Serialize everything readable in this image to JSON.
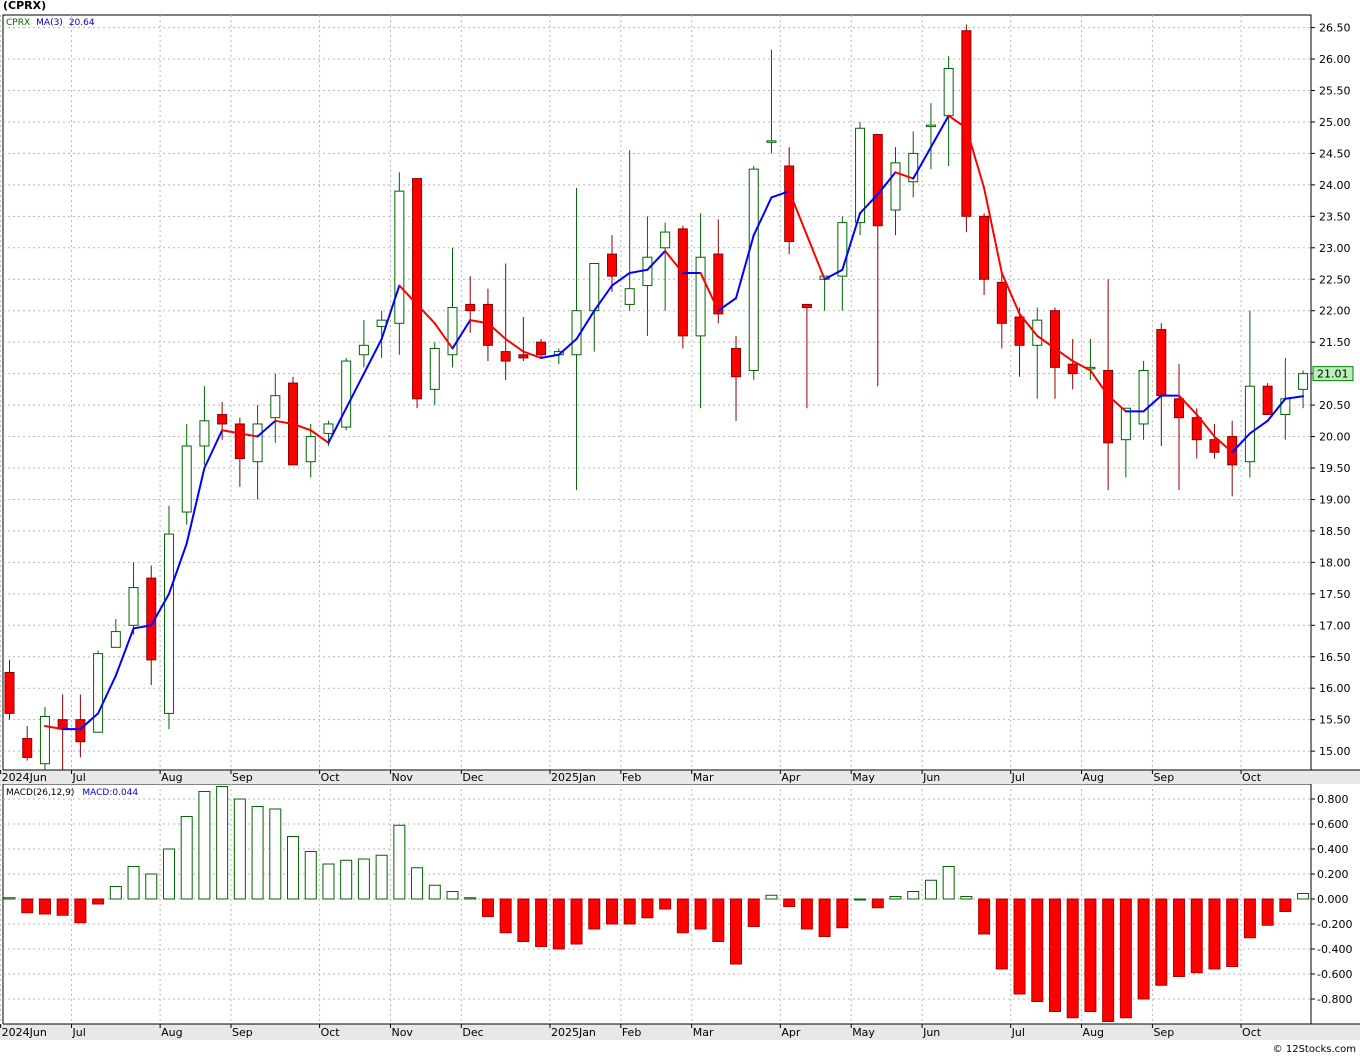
{
  "title": "(CPRX)",
  "credit": "© 12Stocks.com",
  "price_legend": {
    "symbol": "CPRX",
    "ma_label": "MA(3)",
    "ma_value": "20.64"
  },
  "macd_legend": {
    "label": "MACD(26,12,9)",
    "value": "MACD:0.044"
  },
  "last_price_tag": "21.01",
  "colors": {
    "up": "#006400",
    "down": "#ff0000",
    "ma_up": "#0000ff",
    "ma_down": "#ff0000",
    "grid": "#b8b8b8",
    "axis_band": "#e8e8e8"
  },
  "chart_data": [
    {
      "type": "candlestick",
      "panel": "price",
      "ylim": [
        14.7,
        26.7
      ],
      "yticks": [
        "15.00",
        "15.50",
        "16.00",
        "16.50",
        "17.00",
        "17.50",
        "18.00",
        "18.50",
        "19.00",
        "19.50",
        "20.00",
        "20.50",
        "21.00",
        "21.50",
        "22.00",
        "22.50",
        "23.00",
        "23.50",
        "24.00",
        "24.50",
        "25.00",
        "25.50",
        "26.00",
        "26.50"
      ],
      "x_months": [
        {
          "label": "2024Jun",
          "week": 0
        },
        {
          "label": "Jul",
          "week": 4
        },
        {
          "label": "Aug",
          "week": 9
        },
        {
          "label": "Sep",
          "week": 13
        },
        {
          "label": "Oct",
          "week": 18
        },
        {
          "label": "Nov",
          "week": 22
        },
        {
          "label": "Dec",
          "week": 26
        },
        {
          "label": "2025Jan",
          "week": 31
        },
        {
          "label": "Feb",
          "week": 35
        },
        {
          "label": "Mar",
          "week": 39
        },
        {
          "label": "Apr",
          "week": 44
        },
        {
          "label": "May",
          "week": 48
        },
        {
          "label": "Jun",
          "week": 52
        },
        {
          "label": "Jul",
          "week": 57
        },
        {
          "label": "Aug",
          "week": 61
        },
        {
          "label": "Sep",
          "week": 65
        },
        {
          "label": "Oct",
          "week": 70
        }
      ],
      "candles": [
        {
          "o": 16.25,
          "h": 16.45,
          "l": 15.5,
          "c": 15.6
        },
        {
          "o": 15.2,
          "h": 15.4,
          "l": 14.85,
          "c": 14.9
        },
        {
          "o": 14.8,
          "h": 15.7,
          "l": 14.7,
          "c": 15.55
        },
        {
          "o": 15.5,
          "h": 15.9,
          "l": 14.7,
          "c": 15.35
        },
        {
          "o": 15.5,
          "h": 15.9,
          "l": 14.9,
          "c": 15.15
        },
        {
          "o": 15.3,
          "h": 16.6,
          "l": 15.3,
          "c": 16.55
        },
        {
          "o": 16.65,
          "h": 17.1,
          "l": 16.65,
          "c": 16.9
        },
        {
          "o": 17.0,
          "h": 18.0,
          "l": 16.85,
          "c": 17.6
        },
        {
          "o": 17.75,
          "h": 17.95,
          "l": 16.05,
          "c": 16.45
        },
        {
          "o": 15.6,
          "h": 18.9,
          "l": 15.35,
          "c": 18.45
        },
        {
          "o": 18.8,
          "h": 20.2,
          "l": 18.6,
          "c": 19.85
        },
        {
          "o": 19.85,
          "h": 20.8,
          "l": 19.55,
          "c": 20.25
        },
        {
          "o": 20.35,
          "h": 20.55,
          "l": 19.95,
          "c": 20.2
        },
        {
          "o": 20.2,
          "h": 20.3,
          "l": 19.2,
          "c": 19.65
        },
        {
          "o": 19.6,
          "h": 20.5,
          "l": 19.0,
          "c": 20.2
        },
        {
          "o": 20.3,
          "h": 21.0,
          "l": 19.9,
          "c": 20.65
        },
        {
          "o": 20.85,
          "h": 20.95,
          "l": 19.55,
          "c": 19.55
        },
        {
          "o": 19.6,
          "h": 20.2,
          "l": 19.35,
          "c": 20.0
        },
        {
          "o": 20.05,
          "h": 20.25,
          "l": 19.85,
          "c": 20.2
        },
        {
          "o": 20.15,
          "h": 21.25,
          "l": 20.1,
          "c": 21.2
        },
        {
          "o": 21.3,
          "h": 21.85,
          "l": 21.1,
          "c": 21.45
        },
        {
          "o": 21.75,
          "h": 22.0,
          "l": 21.25,
          "c": 21.85
        },
        {
          "o": 21.8,
          "h": 24.2,
          "l": 21.3,
          "c": 23.9
        },
        {
          "o": 24.1,
          "h": 24.1,
          "l": 20.45,
          "c": 20.6
        },
        {
          "o": 20.75,
          "h": 21.5,
          "l": 20.5,
          "c": 21.4
        },
        {
          "o": 21.3,
          "h": 23.0,
          "l": 21.1,
          "c": 22.05
        },
        {
          "o": 22.1,
          "h": 22.55,
          "l": 21.65,
          "c": 22.0
        },
        {
          "o": 22.1,
          "h": 22.35,
          "l": 21.2,
          "c": 21.45
        },
        {
          "o": 21.35,
          "h": 22.75,
          "l": 20.9,
          "c": 21.2
        },
        {
          "o": 21.3,
          "h": 21.9,
          "l": 21.2,
          "c": 21.25
        },
        {
          "o": 21.5,
          "h": 21.55,
          "l": 21.25,
          "c": 21.3
        },
        {
          "o": 21.3,
          "h": 21.4,
          "l": 21.15,
          "c": 21.35
        },
        {
          "o": 21.3,
          "h": 23.95,
          "l": 19.15,
          "c": 22.0
        },
        {
          "o": 22.0,
          "h": 22.5,
          "l": 21.35,
          "c": 22.75
        },
        {
          "o": 22.9,
          "h": 23.2,
          "l": 22.3,
          "c": 22.55
        },
        {
          "o": 22.1,
          "h": 24.55,
          "l": 22.0,
          "c": 22.35
        },
        {
          "o": 22.4,
          "h": 23.5,
          "l": 21.6,
          "c": 22.85
        },
        {
          "o": 23.0,
          "h": 23.4,
          "l": 22.0,
          "c": 23.25
        },
        {
          "o": 23.3,
          "h": 23.35,
          "l": 21.4,
          "c": 21.6
        },
        {
          "o": 21.6,
          "h": 23.55,
          "l": 20.45,
          "c": 22.85
        },
        {
          "o": 22.9,
          "h": 23.45,
          "l": 21.8,
          "c": 21.95
        },
        {
          "o": 21.4,
          "h": 21.6,
          "l": 20.25,
          "c": 20.95
        },
        {
          "o": 21.05,
          "h": 24.3,
          "l": 20.9,
          "c": 24.25
        },
        {
          "o": 24.7,
          "h": 26.15,
          "l": 24.5,
          "c": 24.7
        },
        {
          "o": 24.3,
          "h": 24.6,
          "l": 22.9,
          "c": 23.1
        },
        {
          "o": 22.1,
          "h": 22.1,
          "l": 20.45,
          "c": 22.05
        },
        {
          "o": 22.5,
          "h": 22.5,
          "l": 22.0,
          "c": 22.55
        },
        {
          "o": 22.55,
          "h": 23.5,
          "l": 22.0,
          "c": 23.4
        },
        {
          "o": 23.4,
          "h": 25.0,
          "l": 23.2,
          "c": 24.9
        },
        {
          "o": 24.8,
          "h": 24.8,
          "l": 20.8,
          "c": 23.35
        },
        {
          "o": 23.6,
          "h": 24.6,
          "l": 23.2,
          "c": 24.35
        },
        {
          "o": 24.05,
          "h": 24.85,
          "l": 23.8,
          "c": 24.5
        },
        {
          "o": 24.95,
          "h": 25.3,
          "l": 24.25,
          "c": 24.95
        },
        {
          "o": 25.1,
          "h": 26.05,
          "l": 24.3,
          "c": 25.85
        },
        {
          "o": 26.45,
          "h": 26.55,
          "l": 23.25,
          "c": 23.5
        },
        {
          "o": 23.5,
          "h": 23.55,
          "l": 22.25,
          "c": 22.5
        },
        {
          "o": 22.45,
          "h": 22.6,
          "l": 21.4,
          "c": 21.8
        },
        {
          "o": 21.9,
          "h": 22.05,
          "l": 20.95,
          "c": 21.45
        },
        {
          "o": 21.45,
          "h": 22.05,
          "l": 20.6,
          "c": 21.85
        },
        {
          "o": 22.0,
          "h": 22.05,
          "l": 20.6,
          "c": 21.1
        },
        {
          "o": 21.15,
          "h": 21.55,
          "l": 20.75,
          "c": 21.0
        },
        {
          "o": 21.1,
          "h": 21.55,
          "l": 20.9,
          "c": 21.1
        },
        {
          "o": 21.05,
          "h": 22.5,
          "l": 19.15,
          "c": 19.9
        },
        {
          "o": 19.95,
          "h": 20.45,
          "l": 19.35,
          "c": 20.45
        },
        {
          "o": 20.2,
          "h": 21.2,
          "l": 19.95,
          "c": 21.05
        },
        {
          "o": 21.7,
          "h": 21.8,
          "l": 19.85,
          "c": 20.65
        },
        {
          "o": 20.6,
          "h": 21.15,
          "l": 19.15,
          "c": 20.3
        },
        {
          "o": 20.3,
          "h": 20.45,
          "l": 19.65,
          "c": 19.95
        },
        {
          "o": 19.95,
          "h": 20.2,
          "l": 19.65,
          "c": 19.75
        },
        {
          "o": 20.0,
          "h": 20.25,
          "l": 19.05,
          "c": 19.55
        },
        {
          "o": 19.6,
          "h": 22.0,
          "l": 19.35,
          "c": 20.8
        },
        {
          "o": 20.8,
          "h": 20.85,
          "l": 20.35,
          "c": 20.35
        },
        {
          "o": 20.35,
          "h": 21.25,
          "l": 19.95,
          "c": 20.6
        },
        {
          "o": 20.75,
          "h": 21.05,
          "l": 20.45,
          "c": 21.0
        }
      ],
      "ma3": [
        null,
        null,
        15.4,
        15.35,
        15.35,
        15.6,
        16.2,
        16.95,
        17.0,
        17.5,
        18.3,
        19.5,
        20.1,
        20.05,
        20.0,
        20.25,
        20.2,
        20.1,
        19.9,
        20.45,
        21.0,
        21.55,
        22.4,
        22.1,
        21.8,
        21.4,
        21.85,
        21.8,
        21.55,
        21.35,
        21.25,
        21.3,
        21.55,
        22.0,
        22.4,
        22.6,
        22.65,
        22.95,
        22.6,
        22.6,
        22.0,
        22.2,
        23.2,
        23.8,
        23.9,
        23.2,
        22.5,
        22.65,
        23.55,
        23.85,
        24.2,
        24.1,
        24.6,
        25.1,
        24.9,
        23.95,
        22.6,
        21.95,
        21.6,
        21.4,
        21.2,
        21.05,
        20.65,
        20.4,
        20.4,
        20.65,
        20.65,
        20.35,
        20.0,
        19.75,
        20.05,
        20.25,
        20.6,
        20.64
      ]
    },
    {
      "type": "histogram",
      "panel": "macd",
      "name": "MACD(26,12,9)",
      "ylim": [
        -1.0,
        0.92
      ],
      "yticks": [
        "-0.800",
        "-0.600",
        "-0.400",
        "-0.200",
        "0.000",
        "0.200",
        "0.400",
        "0.600",
        "0.800"
      ],
      "values": [
        0.01,
        -0.11,
        -0.12,
        -0.13,
        -0.19,
        -0.04,
        0.1,
        0.26,
        0.2,
        0.4,
        0.66,
        0.86,
        0.9,
        0.8,
        0.74,
        0.72,
        0.5,
        0.38,
        0.28,
        0.31,
        0.32,
        0.35,
        0.59,
        0.25,
        0.11,
        0.06,
        0.01,
        -0.14,
        -0.27,
        -0.34,
        -0.38,
        -0.4,
        -0.36,
        -0.24,
        -0.2,
        -0.2,
        -0.15,
        -0.08,
        -0.27,
        -0.24,
        -0.34,
        -0.52,
        -0.22,
        0.03,
        -0.06,
        -0.24,
        -0.3,
        -0.23,
        0.0,
        -0.07,
        0.02,
        0.06,
        0.15,
        0.26,
        0.02,
        -0.28,
        -0.56,
        -0.76,
        -0.82,
        -0.9,
        -0.95,
        -0.9,
        -0.98,
        -0.95,
        -0.8,
        -0.69,
        -0.62,
        -0.59,
        -0.56,
        -0.54,
        -0.31,
        -0.21,
        -0.1,
        0.044
      ]
    }
  ]
}
